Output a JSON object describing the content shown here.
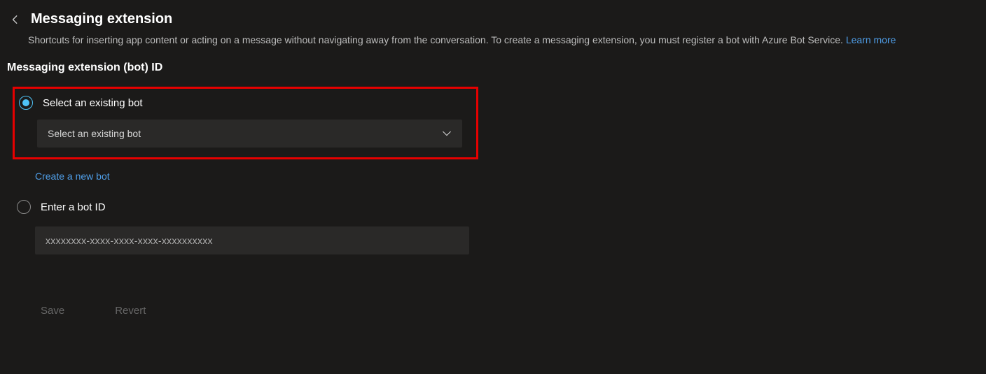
{
  "header": {
    "title": "Messaging extension",
    "description": "Shortcuts for inserting app content or acting on a message without navigating away from the conversation. To create a messaging extension, you must register a bot with Azure Bot Service. ",
    "learn_more": "Learn more"
  },
  "section": {
    "label": "Messaging extension (bot) ID"
  },
  "option_existing": {
    "label": "Select an existing bot",
    "dropdown_label": "Select an existing bot",
    "create_link": "Create a new bot"
  },
  "option_enter": {
    "label": "Enter a bot ID",
    "placeholder": "xxxxxxxx-xxxx-xxxx-xxxx-xxxxxxxxxx"
  },
  "buttons": {
    "save": "Save",
    "revert": "Revert"
  }
}
